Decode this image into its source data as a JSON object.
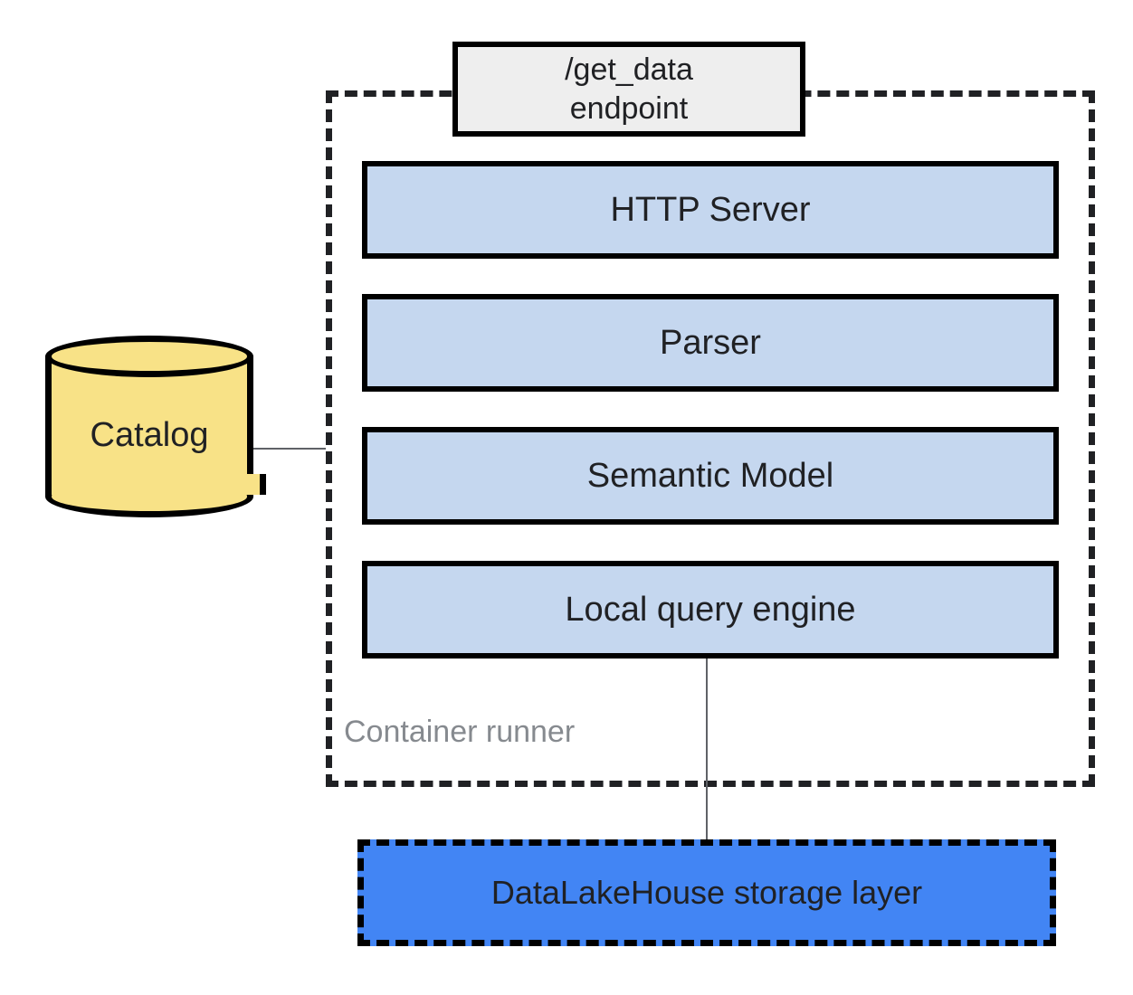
{
  "endpoint": {
    "line1": "/get_data",
    "line2": "endpoint"
  },
  "components": {
    "http_server": "HTTP Server",
    "parser": "Parser",
    "semantic_model": "Semantic Model",
    "local_query_engine": "Local query engine"
  },
  "container_label": "Container runner",
  "catalog_label": "Catalog",
  "storage_label": "DataLakeHouse storage layer",
  "colors": {
    "component_fill": "#c5d7ef",
    "endpoint_fill": "#eeeeee",
    "catalog_fill": "#f8e287",
    "storage_fill": "#4285f4",
    "border": "#000000",
    "text": "#202124",
    "muted_text": "#868a8f"
  }
}
